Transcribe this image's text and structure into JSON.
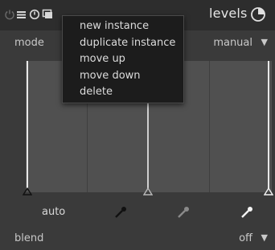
{
  "header": {
    "title": "levels",
    "icons": [
      "power-icon",
      "multi-instance-icon",
      "reset-icon",
      "presets-icon",
      "preset-circle-icon"
    ]
  },
  "mode": {
    "label": "mode",
    "value": "manual"
  },
  "context_menu": {
    "items": [
      "new instance",
      "duplicate instance",
      "move up",
      "move down",
      "delete"
    ]
  },
  "levels": {
    "handles": [
      "black-point",
      "gray-point",
      "white-point"
    ]
  },
  "buttons": {
    "auto_label": "auto",
    "pickers": [
      "black-picker-icon",
      "gray-picker-icon",
      "white-picker-icon"
    ]
  },
  "blend": {
    "label": "blend",
    "value": "off"
  },
  "colors": {
    "background": "#3a3a3a",
    "header": "#2d2d2d",
    "graph": "#505050",
    "menu": "#1c1c1c",
    "text": "#d8d8d8"
  }
}
